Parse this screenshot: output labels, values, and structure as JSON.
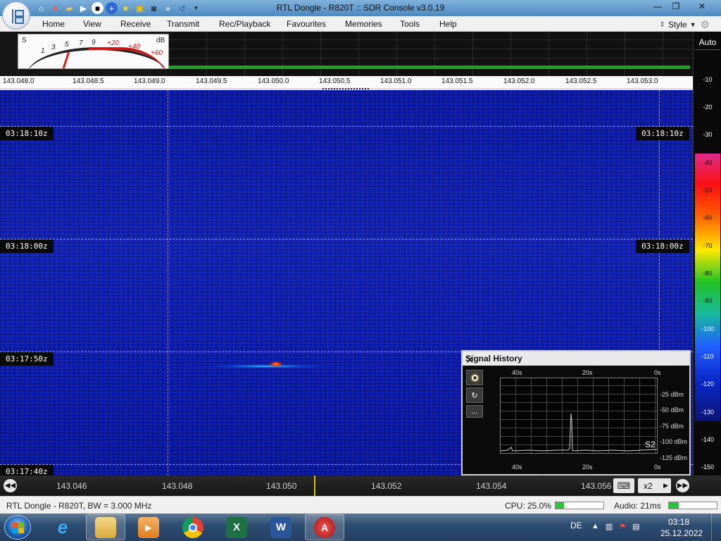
{
  "window": {
    "title": "RTL Dongle - R820T :: SDR Console v3.0.19",
    "controls": {
      "minimize": "—",
      "maximize": "❐",
      "close": "✕"
    }
  },
  "quick_access": [
    "home-icon",
    "lifebuoy-icon",
    "folder-icon",
    "play-icon",
    "stop-icon",
    "add-icon",
    "favourite-star-icon",
    "lock-icon",
    "camera-icon",
    "drop-icon",
    "undo-icon",
    "dropdown-icon"
  ],
  "menu": {
    "items": [
      "Home",
      "View",
      "Receive",
      "Transmit",
      "Rec/Playback",
      "Favourites",
      "Memories",
      "Tools",
      "Help"
    ],
    "style_label": "Style"
  },
  "smeter": {
    "s_label": "S",
    "db_label": "dB",
    "scale": [
      "1",
      "3",
      "5",
      "7",
      "9",
      "+20",
      "+40",
      "+60"
    ],
    "level_s": 1
  },
  "ruler": {
    "labels": [
      "143.048.0",
      "143.048.5",
      "143.049.0",
      "143.049.5",
      "143.050.0",
      "143.050.5",
      "143.051.0",
      "143.051.5",
      "143.052.0",
      "143.052.5",
      "143.053.0"
    ]
  },
  "waterfall": {
    "timestamps": [
      "03:18:10z",
      "03:18:00z",
      "03:17:50z",
      "03:17:40z"
    ]
  },
  "db_scale": {
    "auto_label": "Auto",
    "labels": [
      "-10",
      "-20",
      "-30",
      "-40",
      "-50",
      "-60",
      "-70",
      "-80",
      "-90",
      "-100",
      "-110",
      "-120",
      "-130",
      "-140",
      "-150"
    ]
  },
  "signal_history": {
    "title": "Signal History",
    "close": "✕",
    "top_axis": [
      "40s",
      "20s",
      "0s"
    ],
    "bottom_axis": [
      "40s",
      "20s",
      "0s"
    ],
    "y_labels": [
      "-25 dBm",
      "-50 dBm",
      "-75 dBm",
      "-100 dBm",
      "-125 dBm"
    ],
    "s_reading": "S2",
    "button_more": "..."
  },
  "bottom_nav": {
    "freq_labels": [
      "143.046",
      "143.048",
      "143.050",
      "143.052",
      "143.054",
      "143.056"
    ],
    "zoom": "x2"
  },
  "status": {
    "device": "RTL Dongle - R820T, BW = 3.000 MHz",
    "cpu_label": "CPU: 25.0%",
    "cpu_fraction": 0.18,
    "audio_label": "Audio: 21ms",
    "audio_fraction": 0.2
  },
  "taskbar": {
    "language": "DE",
    "time": "03:18",
    "date": "25.12.2022",
    "apps": [
      "internet-explorer-icon",
      "file-explorer-icon",
      "media-player-icon",
      "chrome-icon",
      "excel-icon",
      "word-icon",
      "sdr-console-icon"
    ]
  },
  "colors": {
    "waterfall_blue": "#1424b6",
    "spectrum_green": "#1fa12a",
    "meter_red": "#c81818",
    "title_blue": "#4d89bf"
  }
}
